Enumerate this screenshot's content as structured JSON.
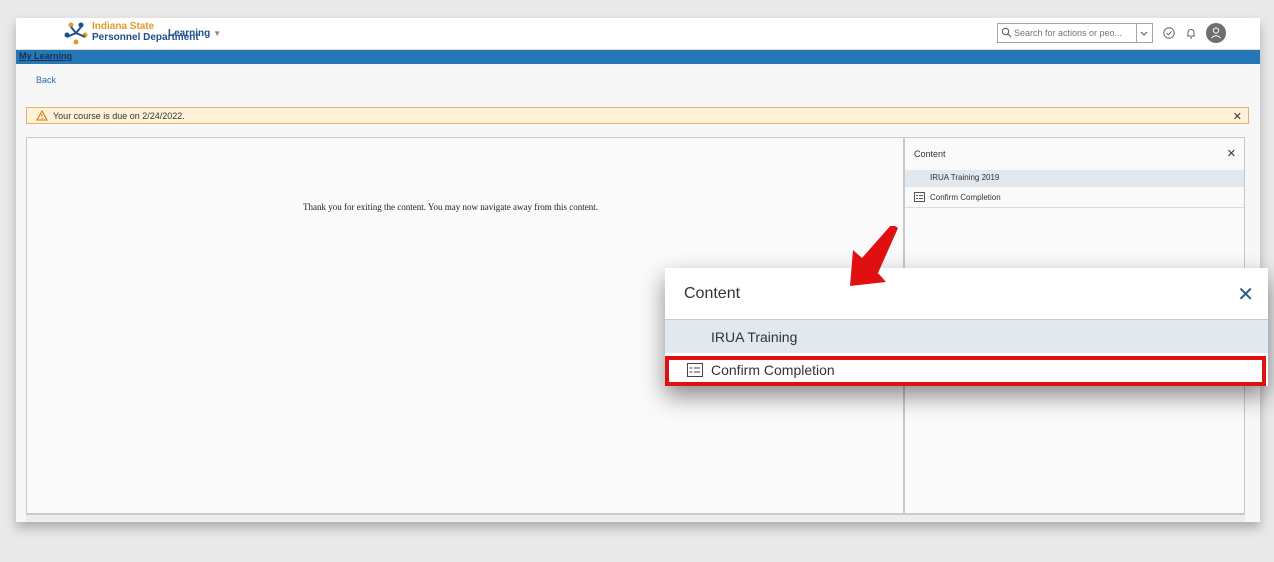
{
  "header": {
    "logo_line1": "Indiana State",
    "logo_line2": "Personnel Department",
    "menu_label": "Learning",
    "search_placeholder": "Search for actions or peo..."
  },
  "nav": {
    "my_learning": "My Learning",
    "back": "Back"
  },
  "alert": {
    "message": "Your course is due on 2/24/2022."
  },
  "content": {
    "message": "Thank you for exiting the content. You may now navigate away from this content."
  },
  "panel": {
    "title": "Content",
    "items": [
      {
        "label": "IRUA Training 2019"
      },
      {
        "label": "Confirm Completion"
      }
    ]
  },
  "zoom": {
    "title": "Content",
    "items": [
      {
        "label": "IRUA Training"
      },
      {
        "label": "Confirm Completion"
      }
    ]
  },
  "colors": {
    "brand_blue": "#2578b5",
    "alert_bg": "#fff2d6",
    "highlight_red": "#e01010"
  }
}
